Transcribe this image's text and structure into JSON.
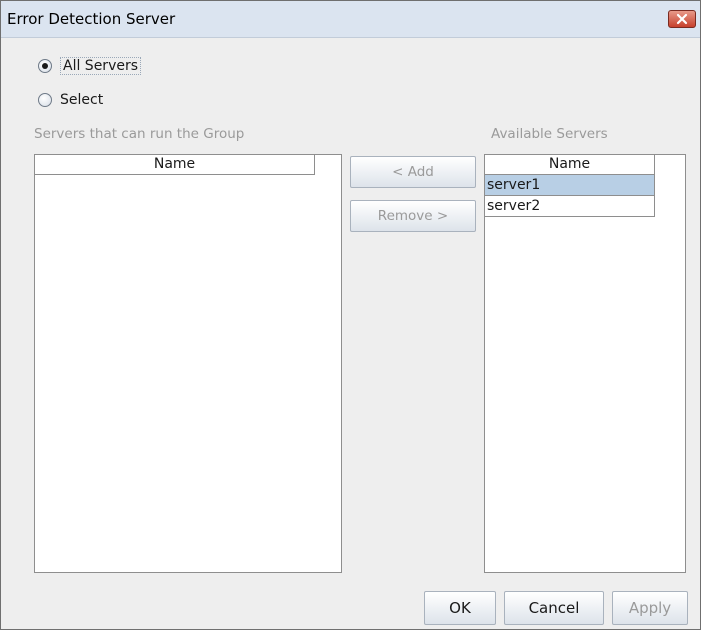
{
  "window": {
    "title": "Error Detection Server"
  },
  "radios": [
    {
      "label": "All Servers",
      "selected": true
    },
    {
      "label": "Select",
      "selected": false
    }
  ],
  "left_panel": {
    "label": "Servers that can run the Group",
    "column": "Name",
    "rows": []
  },
  "middle_buttons": {
    "add": "< Add",
    "remove": "Remove >"
  },
  "right_panel": {
    "label": "Available Servers",
    "column": "Name",
    "rows": [
      "server1",
      "server2"
    ],
    "selected_index": 0
  },
  "footer": {
    "ok": "OK",
    "cancel": "Cancel",
    "apply": "Apply"
  },
  "colors": {
    "selection": "#b8cfe5",
    "titlebar": "#dbe4f0",
    "close": "#c7402c"
  },
  "icons": {
    "close": "close-icon"
  }
}
